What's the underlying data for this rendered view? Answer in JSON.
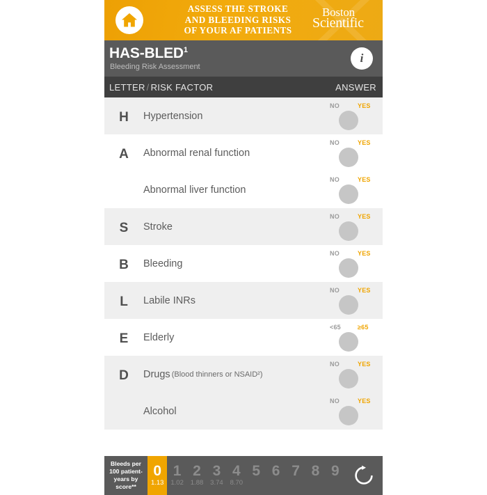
{
  "brand": {
    "home_icon": "home-icon",
    "headline_lines": [
      "ASSESS THE STROKE",
      "AND BLEEDING RISKS",
      "OF YOUR AF PATIENTS"
    ],
    "logo_line1": "Boston",
    "logo_line2": "Scientific",
    "bar_color": "#f0a500"
  },
  "title": {
    "name": "HAS-BLED",
    "footnote": "1",
    "subtitle": "Bleeding Risk Assessment",
    "info_label": "i",
    "bar_color": "#5a5a5a"
  },
  "columns": {
    "letter": "LETTER",
    "separator": "/",
    "risk_factor": "RISK FACTOR",
    "answer": "ANSWER",
    "bar_color": "#3f3f3f"
  },
  "rows": [
    {
      "letter": "H",
      "shaded": true,
      "factors": [
        {
          "label": "Hypertension",
          "note": "",
          "no": "NO",
          "yes": "YES",
          "selected": null
        }
      ]
    },
    {
      "letter": "A",
      "shaded": false,
      "factors": [
        {
          "label": "Abnormal renal function",
          "note": "",
          "no": "NO",
          "yes": "YES",
          "selected": null
        },
        {
          "label": "Abnormal liver function",
          "note": "",
          "no": "NO",
          "yes": "YES",
          "selected": null
        }
      ]
    },
    {
      "letter": "S",
      "shaded": true,
      "factors": [
        {
          "label": "Stroke",
          "note": "",
          "no": "NO",
          "yes": "YES",
          "selected": null
        }
      ]
    },
    {
      "letter": "B",
      "shaded": false,
      "factors": [
        {
          "label": "Bleeding",
          "note": "",
          "no": "NO",
          "yes": "YES",
          "selected": null
        }
      ]
    },
    {
      "letter": "L",
      "shaded": true,
      "factors": [
        {
          "label": "Labile INRs",
          "note": "",
          "no": "NO",
          "yes": "YES",
          "selected": null
        }
      ]
    },
    {
      "letter": "E",
      "shaded": false,
      "factors": [
        {
          "label": "Elderly",
          "note": "",
          "no": "<65",
          "yes": "≥65",
          "selected": null
        }
      ]
    },
    {
      "letter": "D",
      "shaded": true,
      "factors": [
        {
          "label": "Drugs",
          "note": "(Blood thinners or NSAID²)",
          "no": "NO",
          "yes": "YES",
          "selected": null
        },
        {
          "label": "Alcohol",
          "note": "",
          "no": "NO",
          "yes": "YES",
          "selected": null
        }
      ]
    }
  ],
  "score_bar": {
    "legend": "Bleeds per 100 patient-years by score**",
    "active_score": "0",
    "accent_color": "#f0a500",
    "reset_icon": "refresh-icon",
    "cells": [
      {
        "score": "0",
        "value": "1.13",
        "active": true
      },
      {
        "score": "1",
        "value": "1.02",
        "active": false
      },
      {
        "score": "2",
        "value": "1.88",
        "active": false
      },
      {
        "score": "3",
        "value": "3.74",
        "active": false
      },
      {
        "score": "4",
        "value": "8.70",
        "active": false
      },
      {
        "score": "5",
        "value": "",
        "active": false
      },
      {
        "score": "6",
        "value": "",
        "active": false
      },
      {
        "score": "7",
        "value": "",
        "active": false
      },
      {
        "score": "8",
        "value": "",
        "active": false
      },
      {
        "score": "9",
        "value": "",
        "active": false
      }
    ]
  }
}
